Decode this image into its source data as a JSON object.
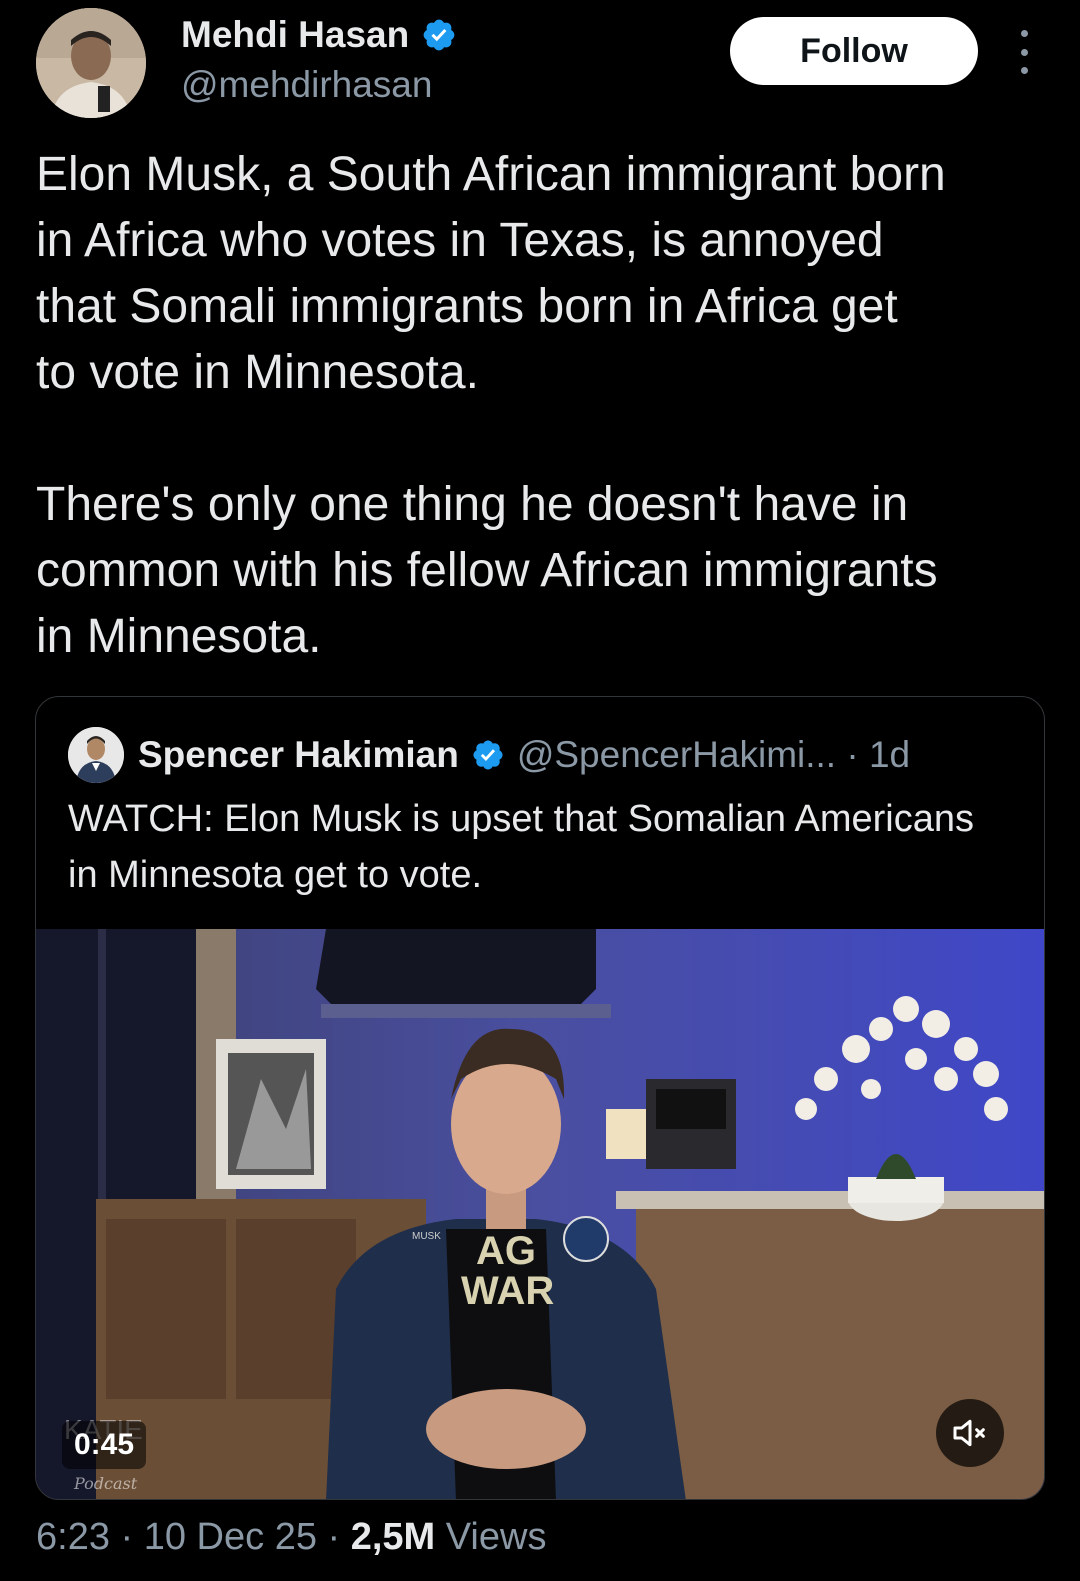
{
  "author": {
    "name": "Mehdi Hasan",
    "handle": "@mehdirhasan",
    "avatar_icon": "author-avatar"
  },
  "follow_label": "Follow",
  "tweet_text": "Elon Musk, a South African immigrant born\nin Africa who votes in Texas, is annoyed\nthat Somali immigrants born in Africa get\nto vote in Minnesota.\n\nThere's only one thing he doesn't have in\ncommon with his fellow African immigrants\nin Minnesota.",
  "quote": {
    "name": "Spencer Hakimian",
    "handle": "@SpencerHakimi... · 1d",
    "text": "WATCH: Elon Musk is upset that Somalian Americans in Minnesota get to vote.",
    "video": {
      "duration": "0:45",
      "watermark_line1": "KATIE",
      "watermark_line2": "Podcast",
      "jacket_patch": "MUSK",
      "shirt_line1": "AG",
      "shirt_line2": "WAR"
    }
  },
  "footer": {
    "time_date": "6:23 · 10 Dec 25 · ",
    "views_count": "2,5M",
    "views_label": " Views"
  },
  "colors": {
    "background": "#000000",
    "text_primary": "#e7e9ea",
    "text_secondary": "#8b98a5",
    "verified_blue": "#1d9bf0",
    "border": "#333639"
  }
}
